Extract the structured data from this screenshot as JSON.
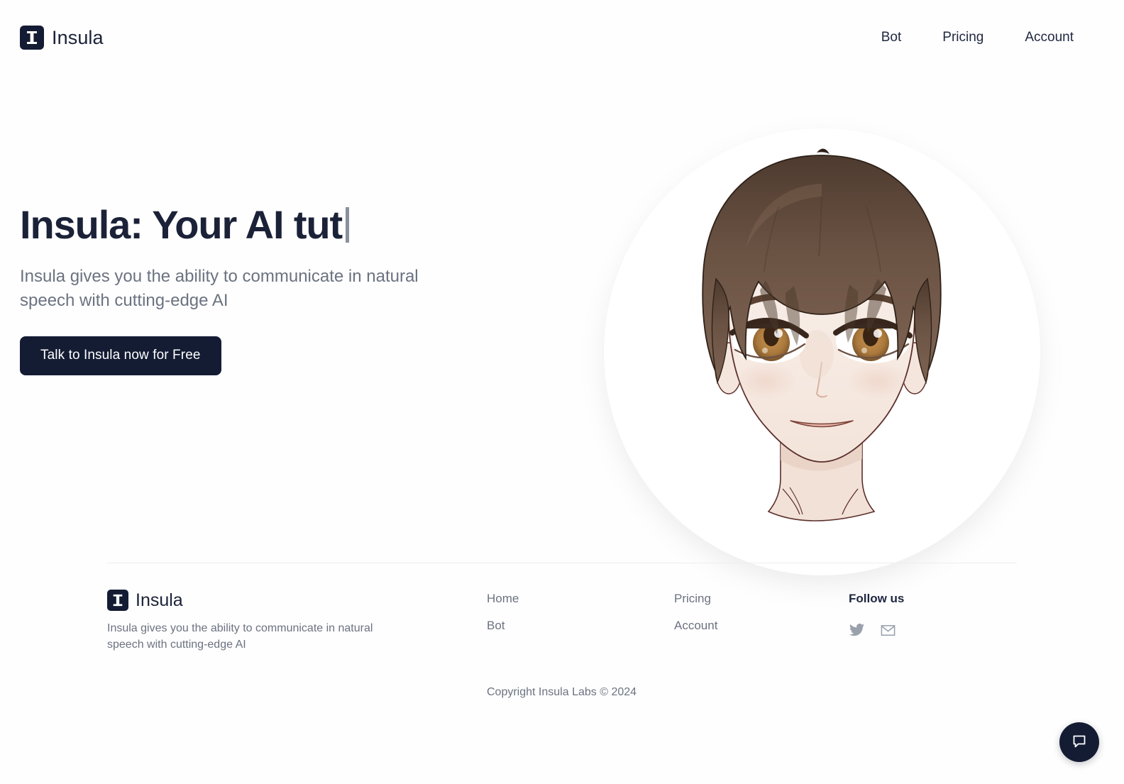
{
  "header": {
    "brand_name": "Insula",
    "logo_icon": "insula-serif-i-icon",
    "nav": [
      {
        "label": "Bot"
      },
      {
        "label": "Pricing"
      },
      {
        "label": "Account"
      }
    ]
  },
  "hero": {
    "headline_typed": "Insula: Your AI tut",
    "caret": "|",
    "subhead": "Insula gives you the ability to communicate in natural speech with cutting-edge AI",
    "cta_label": "Talk to Insula now for Free",
    "avatar_alt": "anime-tutor-avatar"
  },
  "footer": {
    "brand_name": "Insula",
    "logo_icon": "insula-serif-i-icon",
    "tagline": "Insula gives you the ability to communicate in natural speech with cutting-edge AI",
    "col1": [
      {
        "label": "Home"
      },
      {
        "label": "Bot"
      }
    ],
    "col2": [
      {
        "label": "Pricing"
      },
      {
        "label": "Account"
      }
    ],
    "social_title": "Follow us",
    "social": [
      {
        "icon": "twitter-icon"
      },
      {
        "icon": "email-icon"
      }
    ],
    "copyright": "Copyright Insula Labs © 2024"
  },
  "chat": {
    "icon": "chat-bubble-icon"
  },
  "colors": {
    "brand_dark": "#131c33",
    "text_dark": "#1b2238",
    "text_muted": "#6b7280",
    "caret_gray": "#8a909c",
    "divider": "#edeef0",
    "page_bg": "#fefefe",
    "hair": "#6b5344",
    "skin": "#f7ece6",
    "iris": "#b07d3f"
  }
}
